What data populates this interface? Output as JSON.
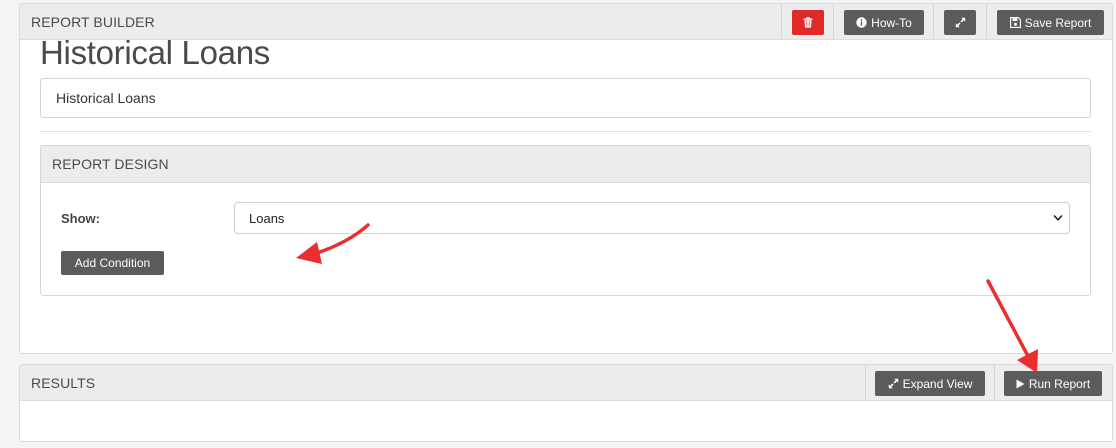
{
  "report_builder": {
    "title": "REPORT BUILDER",
    "buttons": {
      "delete": {
        "icon": "trash-icon"
      },
      "howto": {
        "label": "How-To",
        "icon": "info-circle-icon"
      },
      "expand": {
        "icon": "expand-arrows-icon"
      },
      "save": {
        "label": "Save Report",
        "icon": "floppy-disk-icon"
      }
    },
    "heading": "Historical Loans",
    "name_value": "Historical Loans"
  },
  "report_design": {
    "title": "REPORT DESIGN",
    "show_label": "Show:",
    "show_value": "Loans",
    "add_condition_label": "Add Condition"
  },
  "results": {
    "title": "RESULTS",
    "expand_label": "Expand View",
    "run_label": "Run Report"
  },
  "colors": {
    "danger": "#e02a2a",
    "button": "#5b5b5b",
    "header_bg": "#ececec",
    "annotation_arrow": "#ec2d2d"
  }
}
